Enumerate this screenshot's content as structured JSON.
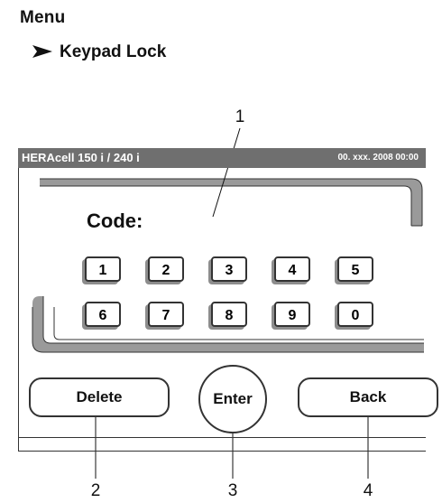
{
  "doc": {
    "heading": "Menu",
    "subheading": "Keypad Lock"
  },
  "callouts": [
    "1",
    "2",
    "3",
    "4"
  ],
  "screen": {
    "model": "HERAcell 150 i / 240 i",
    "datetime": "00. xxx. 2008   00:00",
    "code_label": "Code:"
  },
  "keypad": {
    "keys": [
      "1",
      "2",
      "3",
      "4",
      "5",
      "6",
      "7",
      "8",
      "9",
      "0"
    ]
  },
  "buttons": {
    "delete": "Delete",
    "enter": "Enter",
    "back": "Back"
  },
  "colors": {
    "title_bar": "#6f6f6f",
    "key_shadow": "#8d8d8d",
    "panel_shade": "#9a9a9a"
  }
}
